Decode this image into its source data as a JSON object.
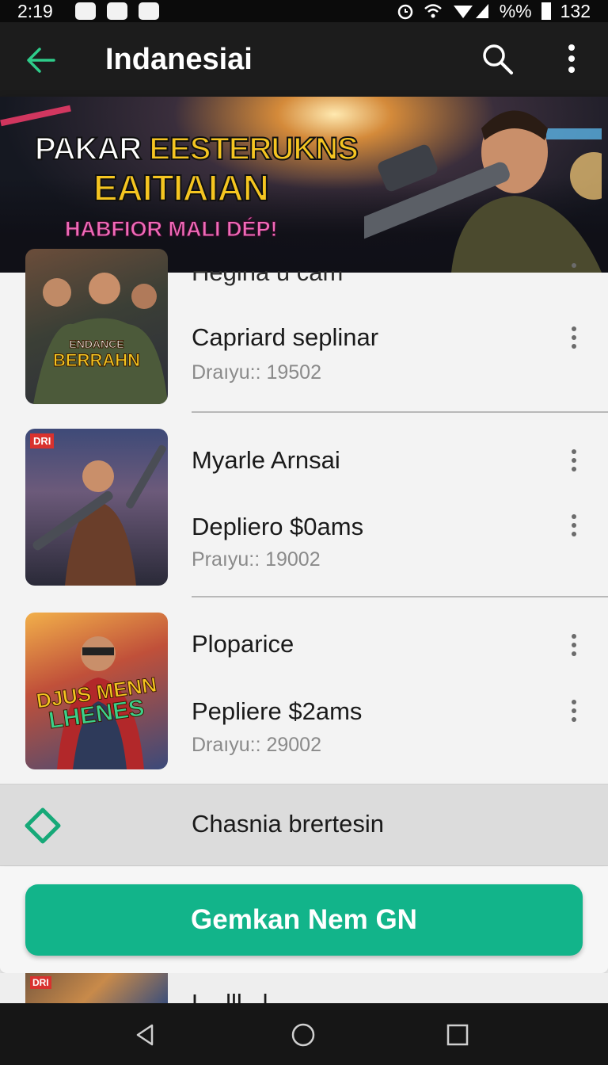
{
  "status_bar": {
    "time": "2:19",
    "battery_text": "%%",
    "right_text": "132",
    "icons": [
      "app-icon-1",
      "app-icon-2",
      "app-icon-3",
      "alarm-icon",
      "wifi-icon",
      "signal-icon",
      "battery-icon"
    ]
  },
  "app_bar": {
    "title": "Indanesiai",
    "back_icon": "arrow-left-icon",
    "search_icon": "search-icon",
    "more_icon": "more-vert-icon",
    "accent_color": "#2ecc8a"
  },
  "banner": {
    "title_word1": "PAKAR",
    "title_word2": "EESTERUKNS",
    "title_line2": "EAITIAIAN",
    "subtitle": "HABFIOR MALI DÉP!"
  },
  "list": {
    "partial_top_title": "Hegina u cam",
    "items": [
      {
        "thumb_title_1": "ENDANCE",
        "thumb_title_2": "BERRAHN",
        "title": "",
        "subtitle": "Capriard seplinar",
        "meta": "Draıyu:: 19502"
      },
      {
        "thumb_badge": "DRI",
        "title": "Myarle Arnsai",
        "subtitle": "Depliero $0ams",
        "meta": "Praıyu:: 19002"
      },
      {
        "thumb_title_1": "DJUS MENN",
        "thumb_title_2": "LHENES",
        "title": "Ploparice",
        "subtitle": "Pepliere $2ams",
        "meta": "Draıyu:: 29002"
      }
    ]
  },
  "filter": {
    "icon": "diamond-outline-icon",
    "label": "Chasnia brertesin"
  },
  "cta": {
    "label": "Gemkan Nem GN",
    "color": "#12b48a"
  },
  "peek": {
    "badge": "DRI",
    "title": "L...lll...l"
  },
  "nav": {
    "back": "nav-back-icon",
    "home": "nav-home-icon",
    "recents": "nav-recents-icon"
  }
}
